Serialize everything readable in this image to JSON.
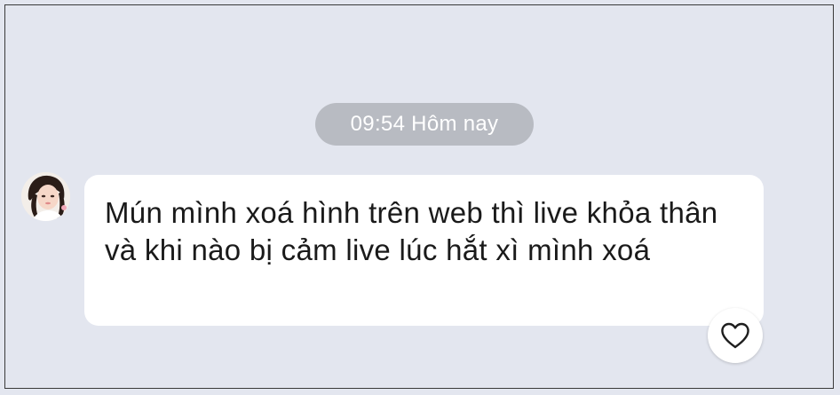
{
  "chat": {
    "timestamp": "09:54 Hôm nay",
    "messages": [
      {
        "text": "Mún mình xoá hình trên web thì live khỏa thân và khi nào bị cảm live lúc hắt xì mình xoá",
        "reaction_icon": "heart-icon"
      }
    ]
  },
  "colors": {
    "background": "#e3e6ef",
    "timestamp_pill": "#b8bbc2",
    "bubble": "#ffffff",
    "text": "#1a1a1a"
  }
}
